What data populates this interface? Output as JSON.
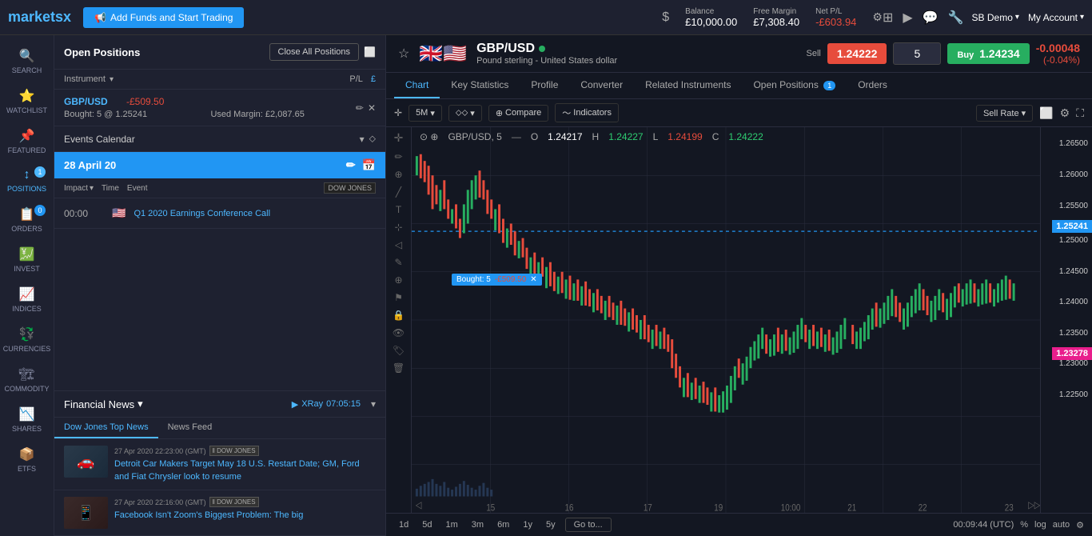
{
  "topnav": {
    "logo": "markets",
    "logo_x": "x",
    "add_funds_label": "Add Funds and Start Trading",
    "balance_label": "Balance",
    "balance_value": "£10,000.00",
    "free_margin_label": "Free Margin",
    "free_margin_value": "£7,308.40",
    "net_pl_label": "Net P/L",
    "net_pl_value": "-£603.94",
    "account_label": "SB Demo",
    "my_account_label": "My Account"
  },
  "sidebar": {
    "items": [
      {
        "label": "SEARCH",
        "icon": "🔍",
        "id": "search"
      },
      {
        "label": "WATCHLIST",
        "icon": "⭐",
        "id": "watchlist"
      },
      {
        "label": "FEATURED",
        "icon": "📌",
        "id": "featured"
      },
      {
        "label": "POSITIONS",
        "icon": "📊",
        "id": "positions",
        "badge": "1",
        "active": true
      },
      {
        "label": "ORDERS",
        "icon": "📋",
        "id": "orders",
        "badge": "0"
      },
      {
        "label": "INVEST",
        "icon": "💹",
        "id": "invest"
      },
      {
        "label": "INDICES",
        "icon": "📈",
        "id": "indices"
      },
      {
        "label": "CURRENCIES",
        "icon": "💱",
        "id": "currencies"
      },
      {
        "label": "COMMODITY",
        "icon": "🏗",
        "id": "commodity"
      },
      {
        "label": "SHARES",
        "icon": "📉",
        "id": "shares"
      },
      {
        "label": "ETFS",
        "icon": "📦",
        "id": "etfs"
      }
    ]
  },
  "positions": {
    "title": "Open Positions",
    "close_all_label": "Close All Positions",
    "subheader_instrument": "Instrument",
    "subheader_pl": "P/L",
    "row": {
      "instrument": "GBP/USD",
      "pl": "-£509.50",
      "bought": "Bought: 5 @ 1.25241",
      "margin": "Used Margin: £2,087.65"
    }
  },
  "events": {
    "title": "Events Calendar",
    "date": "28 April 20",
    "columns": {
      "impact": "Impact",
      "time": "Time",
      "event": "Event"
    },
    "rows": [
      {
        "time": "00:00",
        "flag": "🇺🇸",
        "name": "Q1 2020 Earnings Conference Call"
      }
    ]
  },
  "news": {
    "title": "Financial News",
    "xray_label": "XRay",
    "xray_time": "07:05:15",
    "tabs": [
      {
        "label": "Dow Jones Top News",
        "active": true
      },
      {
        "label": "News Feed",
        "active": false
      }
    ],
    "items": [
      {
        "time": "27 Apr 2020 22:23:00 (GMT)",
        "source": "DOW JONES",
        "headline": "Detroit Car Makers Target May 18 U.S. Restart Date; GM, Ford and Fiat Chrysler look to resume"
      },
      {
        "time": "27 Apr 2020 22:16:00 (GMT)",
        "source": "DOW JONES",
        "headline": "Facebook Isn't Zoom's Biggest Problem: The big"
      }
    ]
  },
  "instrument": {
    "name": "GBP/USD",
    "status": "live",
    "description": "Pound sterling - United States dollar",
    "sell_label": "Sell",
    "sell_price": "1.24222",
    "buy_label": "Buy",
    "buy_price": "1.24234",
    "quantity": "5",
    "change": "-0.00048",
    "change_pct": "(-0.04%)"
  },
  "chart_tabs": [
    {
      "label": "Chart",
      "active": true
    },
    {
      "label": "Key Statistics",
      "active": false
    },
    {
      "label": "Profile",
      "active": false
    },
    {
      "label": "Converter",
      "active": false
    },
    {
      "label": "Related Instruments",
      "active": false
    },
    {
      "label": "Open Positions",
      "active": false,
      "badge": "1"
    },
    {
      "label": "Orders",
      "active": false
    }
  ],
  "chart_toolbar": {
    "timeframe": "5M",
    "chart_type": "⬦⬦",
    "compare_label": "Compare",
    "indicators_label": "Indicators",
    "sell_rate_label": "Sell Rate"
  },
  "chart_ohlc": {
    "symbol": "GBP/USD, 5",
    "o_label": "O",
    "o_value": "1.24217",
    "h_label": "H",
    "h_value": "1.24227",
    "l_label": "L",
    "l_value": "1.24199",
    "c_label": "C",
    "c_value": "1.24222"
  },
  "chart_prices": {
    "p1": {
      "value": "1.26500",
      "top_pct": 5
    },
    "p2": {
      "value": "1.26000",
      "top_pct": 13
    },
    "p3": {
      "value": "1.25500",
      "top_pct": 21
    },
    "p4": {
      "value": "1.25241",
      "top_pct": 27,
      "type": "blue"
    },
    "p5": {
      "value": "1.25000",
      "top_pct": 30
    },
    "p6": {
      "value": "1.24500",
      "top_pct": 38
    },
    "p7": {
      "value": "1.24000",
      "top_pct": 47
    },
    "p8": {
      "value": "1.23500",
      "top_pct": 55
    },
    "p9": {
      "value": "1.23278",
      "top_pct": 60,
      "type": "pink"
    },
    "p10": {
      "value": "1.23000",
      "top_pct": 63
    },
    "p11": {
      "value": "1.22500",
      "top_pct": 71
    }
  },
  "chart_bottom": {
    "timeframes": [
      "1d",
      "5d",
      "1m",
      "3m",
      "6m",
      "1y",
      "5y"
    ],
    "goto_label": "Go to...",
    "time_utc": "00:09:44 (UTC)",
    "percent_label": "%",
    "log_label": "log",
    "auto_label": "auto"
  },
  "position_marker": {
    "label": "Bought: 5",
    "pl": "-£509.50"
  }
}
